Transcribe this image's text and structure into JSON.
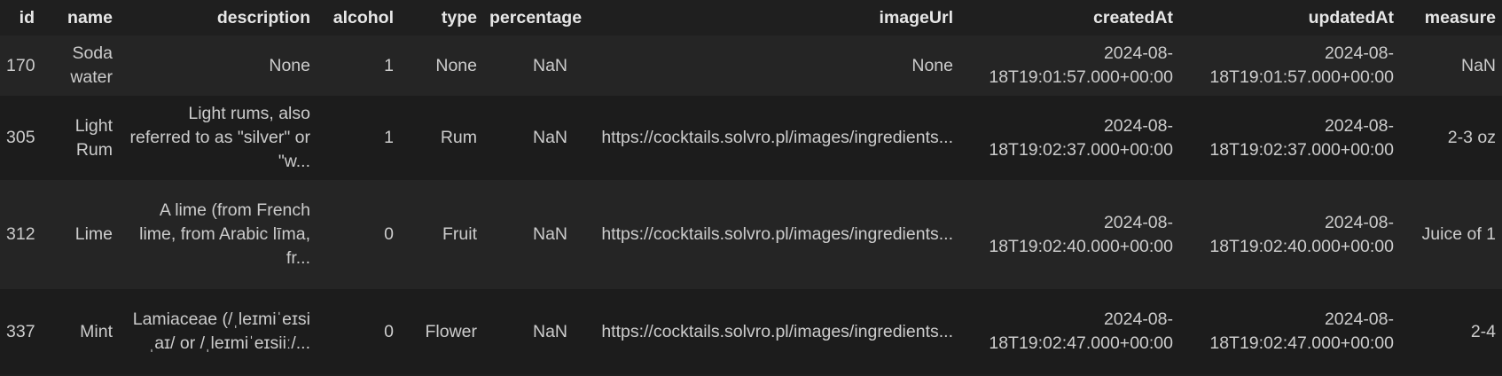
{
  "columns": [
    "id",
    "name",
    "description",
    "alcohol",
    "type",
    "percentage",
    "imageUrl",
    "createdAt",
    "updatedAt",
    "measure"
  ],
  "rows": [
    {
      "id": "170",
      "name": "Soda water",
      "description": "None",
      "alcohol": "1",
      "type": "None",
      "percentage": "NaN",
      "imageUrl": "None",
      "createdAt": "2024-08-18T19:01:57.000+00:00",
      "updatedAt": "2024-08-18T19:01:57.000+00:00",
      "measure": "NaN"
    },
    {
      "id": "305",
      "name": "Light Rum",
      "description": "Light rums, also referred to as \"silver\" or \"w...",
      "alcohol": "1",
      "type": "Rum",
      "percentage": "NaN",
      "imageUrl": "https://cocktails.solvro.pl/images/ingredients...",
      "createdAt": "2024-08-18T19:02:37.000+00:00",
      "updatedAt": "2024-08-18T19:02:37.000+00:00",
      "measure": "2-3 oz"
    },
    {
      "id": "312",
      "name": "Lime",
      "description": "A lime (from French lime, from Arabic līma, fr...",
      "alcohol": "0",
      "type": "Fruit",
      "percentage": "NaN",
      "imageUrl": "https://cocktails.solvro.pl/images/ingredients...",
      "createdAt": "2024-08-18T19:02:40.000+00:00",
      "updatedAt": "2024-08-18T19:02:40.000+00:00",
      "measure": "Juice of 1"
    },
    {
      "id": "337",
      "name": "Mint",
      "description": "Lamiaceae (/ˌleɪmiˈeɪsiˌaɪ/ or /ˌleɪmiˈeɪsiiː/...",
      "alcohol": "0",
      "type": "Flower",
      "percentage": "NaN",
      "imageUrl": "https://cocktails.solvro.pl/images/ingredients...",
      "createdAt": "2024-08-18T19:02:47.000+00:00",
      "updatedAt": "2024-08-18T19:02:47.000+00:00",
      "measure": "2-4"
    }
  ]
}
